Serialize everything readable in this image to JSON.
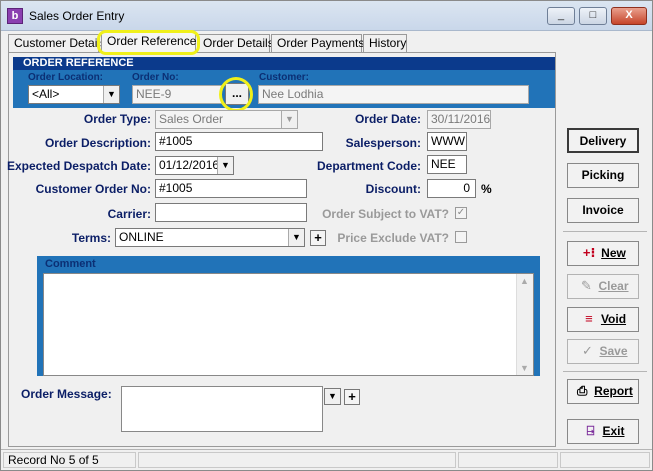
{
  "window": {
    "title": "Sales Order Entry",
    "icon": "app-b-icon",
    "minimize": "_",
    "maximize": "□",
    "close": "X"
  },
  "tabs": [
    {
      "label": "Customer Details"
    },
    {
      "label": "Order Reference"
    },
    {
      "label": "Order Details"
    },
    {
      "label": "Order Payments"
    },
    {
      "label": "History"
    }
  ],
  "order_reference": {
    "header": "ORDER REFERENCE",
    "location_label": "Order Location:",
    "location_value": "<All>",
    "order_no_label": "Order No:",
    "order_no_value": "NEE-9",
    "lookup_button": "...",
    "customer_label": "Customer:",
    "customer_value": "Nee Lodhia"
  },
  "form": {
    "order_type_label": "Order Type:",
    "order_type_value": "Sales Order",
    "order_date_label": "Order Date:",
    "order_date_value": "30/11/2016",
    "description_label": "Order Description:",
    "description_value": "#1005",
    "salesperson_label": "Salesperson:",
    "salesperson_value": "WWW",
    "despatch_label": "Expected Despatch Date:",
    "despatch_value": "01/12/2016",
    "department_label": "Department Code:",
    "department_value": "NEE",
    "customer_order_label": "Customer Order No:",
    "customer_order_value": "#1005",
    "discount_label": "Discount:",
    "discount_value": "0",
    "discount_unit": "%",
    "carrier_label": "Carrier:",
    "carrier_value": "",
    "vat_label": "Order Subject to VAT?",
    "vat_checked": true,
    "price_excl_label": "Price Exclude VAT?",
    "price_excl_checked": false,
    "terms_label": "Terms:",
    "terms_value": "ONLINE",
    "plus": "+"
  },
  "comment": {
    "label": "Comment",
    "value": ""
  },
  "message": {
    "label": "Order Message:",
    "value": ""
  },
  "side_buttons": {
    "delivery": "Delivery",
    "picking": "Picking",
    "invoice": "Invoice",
    "new": "New",
    "clear": "Clear",
    "void": "Void",
    "save": "Save",
    "report": "Report",
    "exit": "Exit"
  },
  "status": {
    "record": "Record No 5 of 5"
  },
  "colors": {
    "band": "#2173b8",
    "header": "#0b3a8c",
    "label": "#0b1e66",
    "highlight": "#f0f01a"
  }
}
